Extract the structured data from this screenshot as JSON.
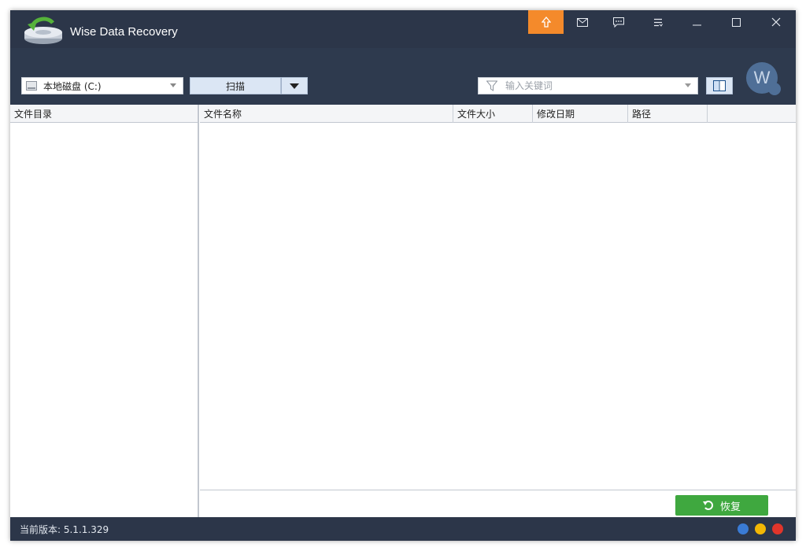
{
  "window": {
    "title": "Wise Data Recovery"
  },
  "titlebar": {
    "buttons": [
      "upgrade-icon",
      "mail-icon",
      "feedback-icon",
      "menu-icon",
      "minimize-icon",
      "maximize-icon",
      "close-icon"
    ],
    "accent": "#f48a2b"
  },
  "toolbar": {
    "drive": "本地磁盘 (C:)",
    "scan_label": "扫描",
    "search_placeholder": "输入关键词",
    "avatar_letter": "W"
  },
  "directory_pane": {
    "header": "文件目录"
  },
  "file_list": {
    "columns": [
      "文件名称",
      "文件大小",
      "修改日期",
      "路径"
    ],
    "rows": []
  },
  "footer": {
    "recover_label": "恢复"
  },
  "status": {
    "version_label": "当前版本: 5.1.1.329"
  },
  "colors": {
    "titlebar": "#2c3649",
    "toolbar": "#2e3a4e",
    "recover": "#3fa83f"
  }
}
